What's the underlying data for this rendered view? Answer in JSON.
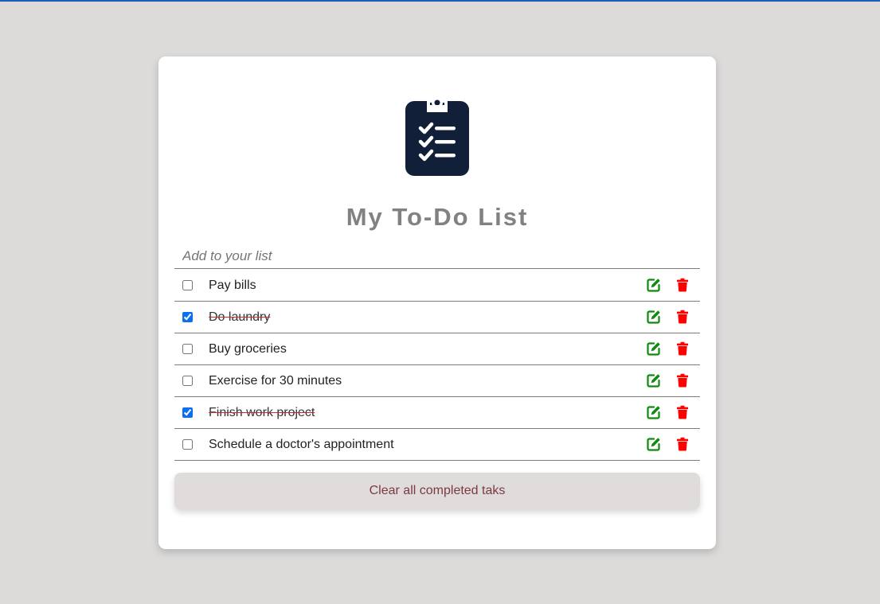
{
  "colors": {
    "page_background": "#dcdbda",
    "top_accent": "#1a5fb4",
    "logo": "#121f38",
    "title": "#818181",
    "edit_icon": "#0e8a0e",
    "delete_icon": "#ff0000",
    "clear_text": "#7b3a42"
  },
  "header": {
    "logo_icon": "clipboard-checklist-icon",
    "title": "My To-Do List"
  },
  "add_input": {
    "placeholder": "Add to your list",
    "value": ""
  },
  "todos": [
    {
      "text": "Pay bills",
      "completed": false
    },
    {
      "text": "Do laundry",
      "completed": true
    },
    {
      "text": "Buy groceries",
      "completed": false
    },
    {
      "text": "Exercise for 30 minutes",
      "completed": false
    },
    {
      "text": "Finish work project",
      "completed": true
    },
    {
      "text": "Schedule a doctor's appointment",
      "completed": false
    }
  ],
  "item_actions": {
    "edit_icon": "edit-pencil-square-icon",
    "delete_icon": "trash-icon"
  },
  "footer": {
    "clear_label": "Clear all completed taks"
  }
}
